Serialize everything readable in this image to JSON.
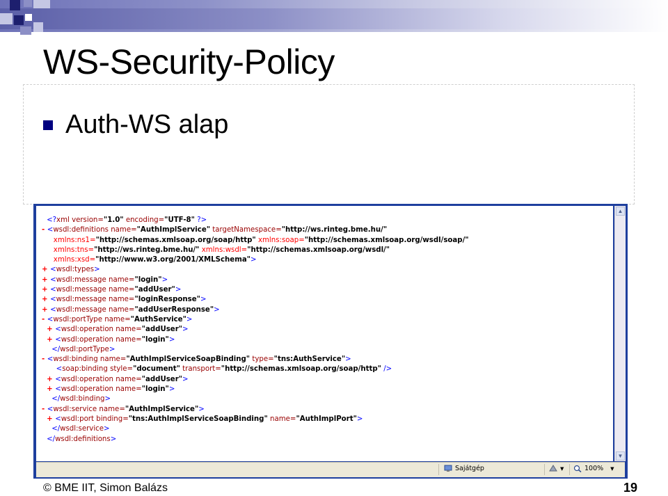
{
  "slide": {
    "title": "WS-Security-Policy",
    "bullet": "Auth-WS alap",
    "footer_text": "© BME IIT, Simon Balázs",
    "page_number": "19",
    "colors": {
      "accent": "#000080",
      "window_frame": "#1e3f9e"
    }
  },
  "xml_view": {
    "lines": [
      {
        "marker": "",
        "parts": [
          [
            "br",
            "<?"
          ],
          [
            "tag",
            "xml version="
          ],
          [
            "val",
            "\"1.0\""
          ],
          [
            "tag",
            " encoding="
          ],
          [
            "val",
            "\"UTF-8\""
          ],
          [
            "br",
            " ?>"
          ]
        ]
      },
      {
        "marker": "-",
        "parts": [
          [
            "br",
            "<"
          ],
          [
            "tag",
            "wsdl:definitions name="
          ],
          [
            "val",
            "\"AuthImplService\""
          ],
          [
            "tag",
            " targetNamespace="
          ],
          [
            "val",
            "\"http://ws.rinteg.bme.hu/\""
          ]
        ]
      },
      {
        "marker": "",
        "parts": [
          [
            "ns",
            "   xmlns:ns1="
          ],
          [
            "val",
            "\"http://schemas.xmlsoap.org/soap/http\""
          ],
          [
            "ns",
            " xmlns:soap="
          ],
          [
            "val",
            "\"http://schemas.xmlsoap.org/wsdl/soap/\""
          ]
        ]
      },
      {
        "marker": "",
        "parts": [
          [
            "ns",
            "   xmlns:tns="
          ],
          [
            "val",
            "\"http://ws.rinteg.bme.hu/\""
          ],
          [
            "ns",
            " xmlns:wsdl="
          ],
          [
            "val",
            "\"http://schemas.xmlsoap.org/wsdl/\""
          ]
        ]
      },
      {
        "marker": "",
        "parts": [
          [
            "ns",
            "   xmlns:xsd="
          ],
          [
            "val",
            "\"http://www.w3.org/2001/XMLSchema\""
          ],
          [
            "br",
            ">"
          ]
        ]
      },
      {
        "marker": "+",
        "parts": [
          [
            "br",
            "<"
          ],
          [
            "tag",
            "wsdl:types"
          ],
          [
            "br",
            ">"
          ]
        ]
      },
      {
        "marker": "+",
        "parts": [
          [
            "br",
            "<"
          ],
          [
            "tag",
            "wsdl:message name="
          ],
          [
            "val",
            "\"login\""
          ],
          [
            "br",
            ">"
          ]
        ]
      },
      {
        "marker": "+",
        "parts": [
          [
            "br",
            "<"
          ],
          [
            "tag",
            "wsdl:message name="
          ],
          [
            "val",
            "\"addUser\""
          ],
          [
            "br",
            ">"
          ]
        ]
      },
      {
        "marker": "+",
        "parts": [
          [
            "br",
            "<"
          ],
          [
            "tag",
            "wsdl:message name="
          ],
          [
            "val",
            "\"loginResponse\""
          ],
          [
            "br",
            ">"
          ]
        ]
      },
      {
        "marker": "+",
        "parts": [
          [
            "br",
            "<"
          ],
          [
            "tag",
            "wsdl:message name="
          ],
          [
            "val",
            "\"addUserResponse\""
          ],
          [
            "br",
            ">"
          ]
        ]
      },
      {
        "marker": "-",
        "parts": [
          [
            "br",
            "<"
          ],
          [
            "tag",
            "wsdl:portType name="
          ],
          [
            "val",
            "\"AuthService\""
          ],
          [
            "br",
            ">"
          ]
        ]
      },
      {
        "marker": " +",
        "parts": [
          [
            "br",
            "<"
          ],
          [
            "tag",
            "wsdl:operation name="
          ],
          [
            "val",
            "\"addUser\""
          ],
          [
            "br",
            ">"
          ]
        ]
      },
      {
        "marker": " +",
        "parts": [
          [
            "br",
            "<"
          ],
          [
            "tag",
            "wsdl:operation name="
          ],
          [
            "val",
            "\"login\""
          ],
          [
            "br",
            ">"
          ]
        ]
      },
      {
        "marker": "  ",
        "parts": [
          [
            "br",
            "</"
          ],
          [
            "tag",
            "wsdl:portType"
          ],
          [
            "br",
            ">"
          ]
        ]
      },
      {
        "marker": "-",
        "parts": [
          [
            "br",
            "<"
          ],
          [
            "tag",
            "wsdl:binding name="
          ],
          [
            "val",
            "\"AuthImplServiceSoapBinding\""
          ],
          [
            "tag",
            " type="
          ],
          [
            "val",
            "\"tns:AuthService\""
          ],
          [
            "br",
            ">"
          ]
        ]
      },
      {
        "marker": "  ",
        "parts": [
          [
            "br",
            "  <"
          ],
          [
            "tag",
            "soap:binding style="
          ],
          [
            "val",
            "\"document\""
          ],
          [
            "tag",
            " transport="
          ],
          [
            "val",
            "\"http://schemas.xmlsoap.org/soap/http\""
          ],
          [
            "br",
            " />"
          ]
        ]
      },
      {
        "marker": " +",
        "parts": [
          [
            "br",
            "<"
          ],
          [
            "tag",
            "wsdl:operation name="
          ],
          [
            "val",
            "\"addUser\""
          ],
          [
            "br",
            ">"
          ]
        ]
      },
      {
        "marker": " +",
        "parts": [
          [
            "br",
            "<"
          ],
          [
            "tag",
            "wsdl:operation name="
          ],
          [
            "val",
            "\"login\""
          ],
          [
            "br",
            ">"
          ]
        ]
      },
      {
        "marker": "  ",
        "parts": [
          [
            "br",
            "</"
          ],
          [
            "tag",
            "wsdl:binding"
          ],
          [
            "br",
            ">"
          ]
        ]
      },
      {
        "marker": "-",
        "parts": [
          [
            "br",
            "<"
          ],
          [
            "tag",
            "wsdl:service name="
          ],
          [
            "val",
            "\"AuthImplService\""
          ],
          [
            "br",
            ">"
          ]
        ]
      },
      {
        "marker": " +",
        "parts": [
          [
            "br",
            "<"
          ],
          [
            "tag",
            "wsdl:port binding="
          ],
          [
            "val",
            "\"tns:AuthImplServiceSoapBinding\""
          ],
          [
            "tag",
            " name="
          ],
          [
            "val",
            "\"AuthImplPort\""
          ],
          [
            "br",
            ">"
          ]
        ]
      },
      {
        "marker": "  ",
        "parts": [
          [
            "br",
            "</"
          ],
          [
            "tag",
            "wsdl:service"
          ],
          [
            "br",
            ">"
          ]
        ]
      },
      {
        "marker": "",
        "parts": [
          [
            "br",
            "</"
          ],
          [
            "tag",
            "wsdl:definitions"
          ],
          [
            "br",
            ">"
          ]
        ]
      }
    ]
  },
  "statusbar": {
    "zone_label": "Sajátgép",
    "zoom_label": "100%",
    "icons": [
      "computer-icon",
      "security-icon",
      "zoom-icon"
    ]
  }
}
